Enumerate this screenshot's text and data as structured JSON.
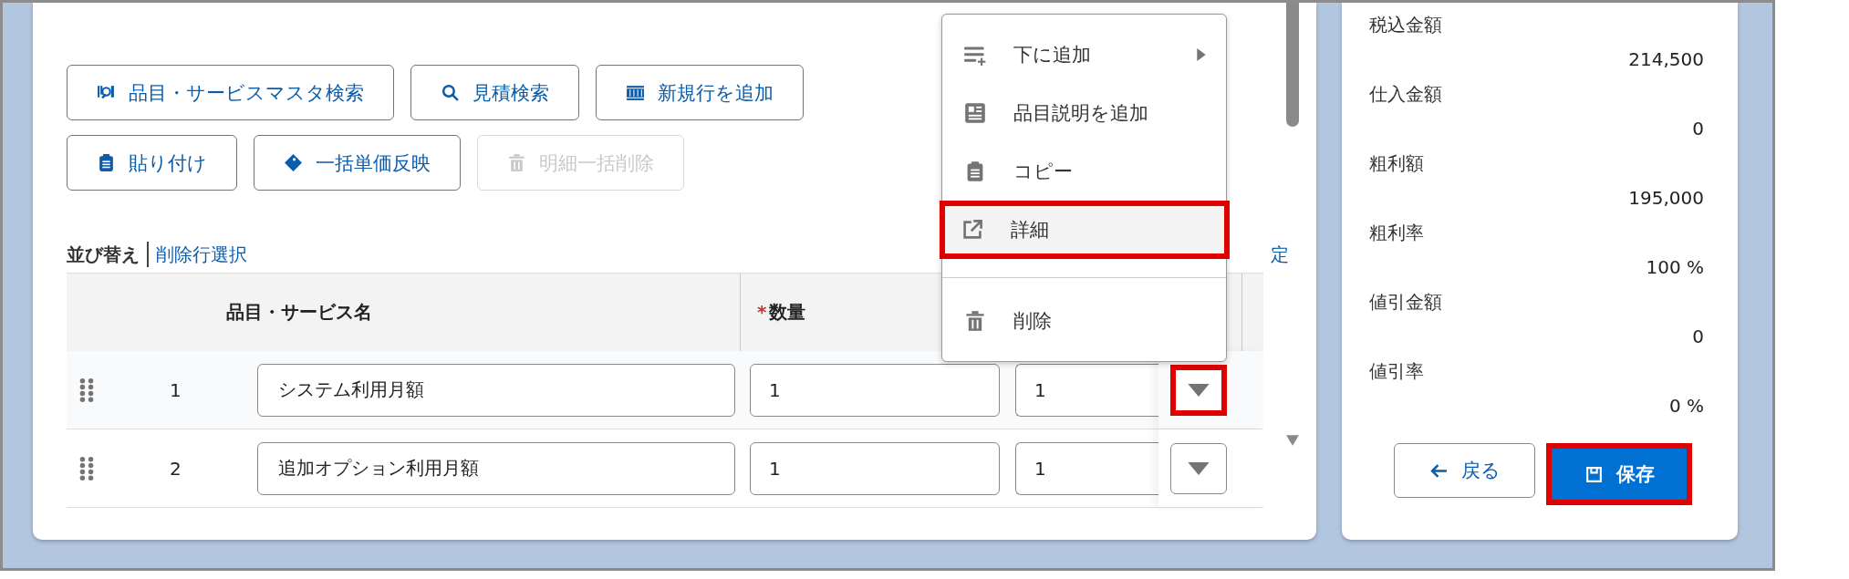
{
  "toolbar": {
    "buttons": [
      {
        "label": "品目・サービスマスタ検索",
        "kind": "master-search",
        "disabled": false
      },
      {
        "label": "見積検索",
        "kind": "search",
        "disabled": false
      },
      {
        "label": "新規行を追加",
        "kind": "rows",
        "disabled": false
      },
      {
        "label": "貼り付け",
        "kind": "clipboard",
        "disabled": false
      },
      {
        "label": "一括単価反映",
        "kind": "tag",
        "disabled": false
      },
      {
        "label": "明細一括削除",
        "kind": "trash",
        "disabled": true
      }
    ]
  },
  "sort_bar": {
    "sort_label": "並び替え",
    "delete_select_link": "削除行選択",
    "cut_link": "定"
  },
  "table": {
    "columns": [
      {
        "label": "品目・サービス名"
      },
      {
        "label": "数量",
        "required_mark": "*"
      }
    ],
    "rows": [
      {
        "number": "1",
        "name": "システム利用月額",
        "quantity": "1",
        "column_3": "1",
        "annotated": true
      },
      {
        "number": "2",
        "name": "追加オプション利用月額",
        "quantity": "1",
        "column_3": "1",
        "annotated": false
      }
    ]
  },
  "menu": {
    "items": [
      {
        "label": "下に追加",
        "kind": "add-below",
        "submenu": true,
        "selected": false,
        "annotated": false,
        "divider_before": false
      },
      {
        "label": "品目説明を追加",
        "kind": "description",
        "submenu": false,
        "selected": false,
        "annotated": false,
        "divider_before": false
      },
      {
        "label": "コピー",
        "kind": "clipboard",
        "submenu": false,
        "selected": false,
        "annotated": false,
        "divider_before": false
      },
      {
        "label": "詳細",
        "kind": "external",
        "submenu": false,
        "selected": true,
        "annotated": true,
        "divider_before": false
      },
      {
        "label": "削除",
        "kind": "trash",
        "submenu": false,
        "selected": false,
        "annotated": false,
        "divider_before": true
      }
    ]
  },
  "summary": {
    "items": [
      {
        "label": "税込金額",
        "value": "214,500"
      },
      {
        "label": "仕入金額",
        "value": "0"
      },
      {
        "label": "粗利額",
        "value": "195,000"
      },
      {
        "label": "粗利率",
        "value": "100 %"
      },
      {
        "label": "値引金額",
        "value": "0"
      },
      {
        "label": "値引率",
        "value": "0 %"
      }
    ]
  },
  "actions": {
    "back": {
      "label": "戻る",
      "annotated": false
    },
    "save": {
      "label": "保存",
      "annotated": true
    }
  }
}
